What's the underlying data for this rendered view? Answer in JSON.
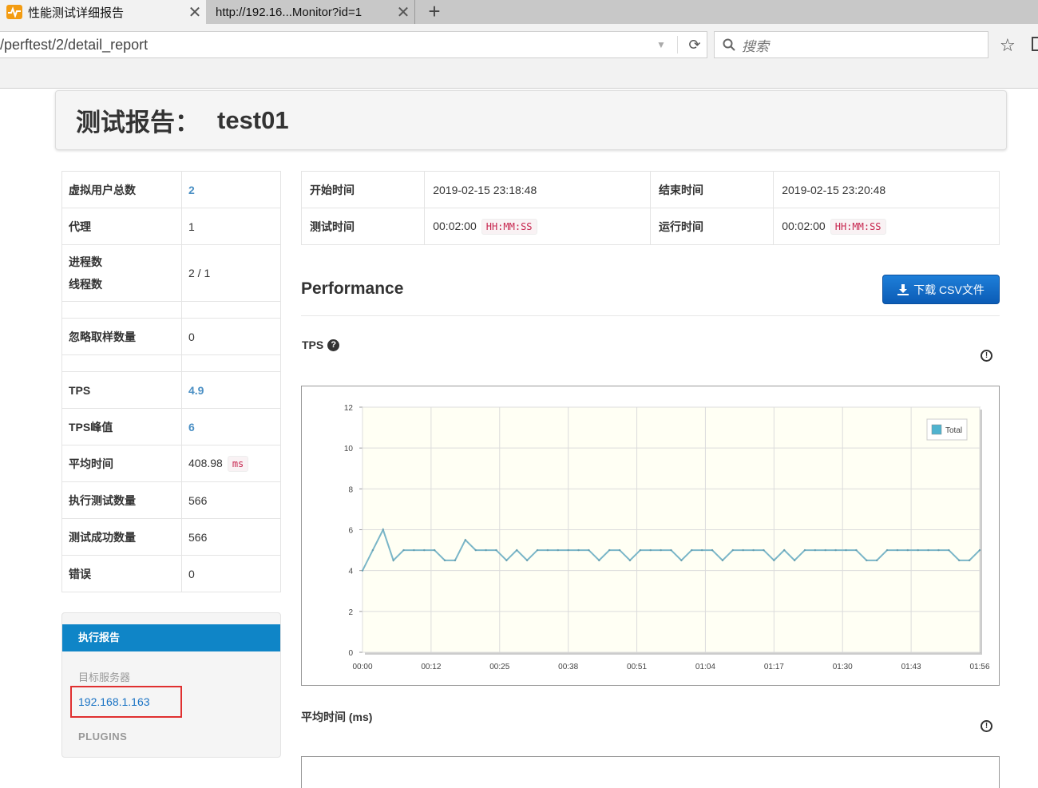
{
  "browser": {
    "tabs": [
      {
        "title": "性能测试详细报告",
        "active": true
      },
      {
        "title": "http://192.16...Monitor?id=1",
        "active": false
      }
    ],
    "new_tab": "+",
    "url": "/perftest/2/detail_report",
    "search_placeholder": "搜索"
  },
  "report": {
    "title_prefix": "测试报告：",
    "test_name": "test01"
  },
  "stats": {
    "vusers_label": "虚拟用户总数",
    "vusers_value": "2",
    "agents_label": "代理",
    "agents_value": "1",
    "process_label": "进程数",
    "thread_label": "线程数",
    "process_thread_value": "2 / 1",
    "ignore_label": "忽略取样数量",
    "ignore_value": "0",
    "tps_label": "TPS",
    "tps_value": "4.9",
    "peak_label": "TPS峰值",
    "peak_value": "6",
    "mean_label": "平均时间",
    "mean_value": "408.98",
    "mean_unit": "ms",
    "exec_label": "执行测试数量",
    "exec_value": "566",
    "success_label": "测试成功数量",
    "success_value": "566",
    "error_label": "错误",
    "error_value": "0"
  },
  "side_panel": {
    "header": "执行报告",
    "target_label": "目标服务器",
    "server": "192.168.1.163",
    "plugins": "PLUGINS"
  },
  "times": {
    "start_label": "开始时间",
    "start_value": "2019-02-15 23:18:48",
    "end_label": "结束时间",
    "end_value": "2019-02-15 23:20:48",
    "test_time_label": "测试时间",
    "test_time_value": "00:02:00",
    "run_time_label": "运行时间",
    "run_time_value": "00:02:00",
    "time_format": "HH:MM:SS"
  },
  "performance": {
    "title": "Performance",
    "csv_button": "下载 CSV文件",
    "tps_chart_label": "TPS",
    "avg_chart_label": "平均时间 (ms)"
  },
  "chart_data": {
    "type": "line",
    "title": "",
    "xlabel": "",
    "ylabel": "",
    "ylim": [
      0,
      12
    ],
    "yticks": [
      0,
      2,
      4,
      6,
      8,
      10,
      12
    ],
    "xtick_labels": [
      "00:00",
      "00:12",
      "00:25",
      "00:38",
      "00:51",
      "01:04",
      "01:17",
      "01:30",
      "01:43",
      "01:56"
    ],
    "grid": true,
    "legend": "top-right",
    "colors": {
      "line": "#7ab6c8",
      "background": "#fffff4",
      "legend_swatch": "#4fb3cf"
    },
    "series": [
      {
        "name": "Total",
        "values": [
          4,
          5,
          6,
          4.5,
          5,
          5,
          5,
          5,
          4.5,
          4.5,
          5.5,
          5,
          5,
          5,
          4.5,
          5,
          4.5,
          5,
          5,
          5,
          5,
          5,
          5,
          4.5,
          5,
          5,
          4.5,
          5,
          5,
          5,
          5,
          4.5,
          5,
          5,
          5,
          4.5,
          5,
          5,
          5,
          5,
          4.5,
          5,
          4.5,
          5,
          5,
          5,
          5,
          5,
          5,
          4.5,
          4.5,
          5,
          5,
          5,
          5,
          5,
          5,
          5,
          4.5,
          4.5,
          5
        ]
      }
    ]
  }
}
